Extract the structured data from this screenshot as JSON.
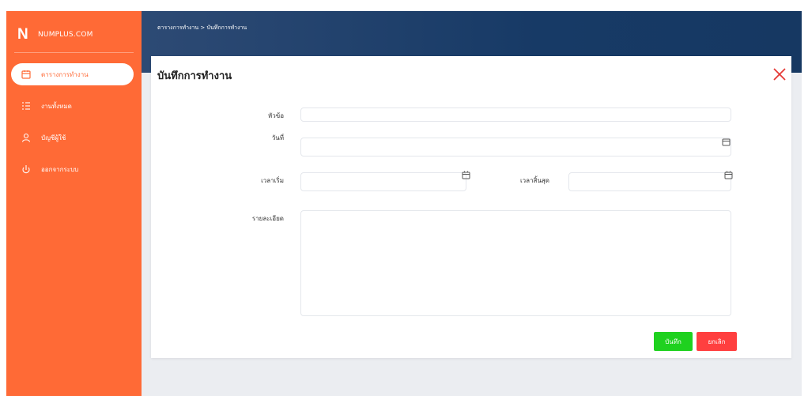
{
  "brand": {
    "logo_letter": "N",
    "name": "NUMPLUS.COM"
  },
  "sidebar": {
    "items": [
      {
        "label": "ตารางการทำงาน",
        "icon": "calendar-icon",
        "active": true
      },
      {
        "label": "งานทั้งหมด",
        "icon": "list-icon",
        "active": false
      },
      {
        "label": "บัญชีผู้ใช้",
        "icon": "user-icon",
        "active": false
      },
      {
        "label": "ออกจากระบบ",
        "icon": "logout-icon",
        "active": false
      }
    ]
  },
  "header": {
    "breadcrumb": "ตารางการทำงาน > บันทึกการทำงาน"
  },
  "form": {
    "title": "บันทึกการทำงาน",
    "topic_label": "หัวข้อ",
    "topic_value": "",
    "date_label": "วันที่",
    "date_value": "",
    "start_label": "เวลาเริ่ม",
    "start_value": "",
    "end_label": "เวลาสิ้นสุด",
    "end_value": "",
    "detail_label": "รายละเอียด",
    "detail_value": "",
    "save_label": "บันทึก",
    "cancel_label": "ยกเลิก"
  },
  "colors": {
    "sidebar": "#ff6a36",
    "header": "#1b3d6b",
    "save": "#1fd11f",
    "cancel": "#ff3f3f",
    "close": "#e53935"
  }
}
